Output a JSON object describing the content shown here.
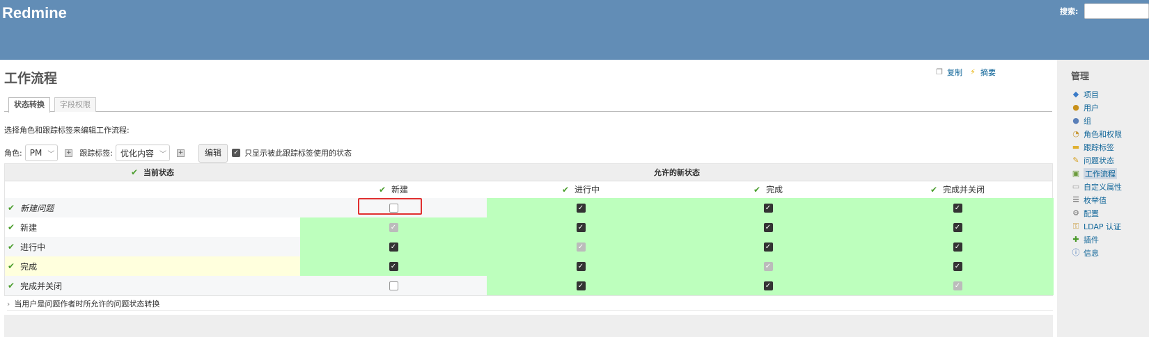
{
  "header": {
    "app_title": "Redmine",
    "search_label": "搜索:",
    "search_placeholder": ""
  },
  "page": {
    "title": "工作流程",
    "copy_label": "复制",
    "summary_label": "摘要"
  },
  "tabs": [
    {
      "label": "状态转换",
      "selected": true
    },
    {
      "label": "字段权限",
      "selected": false
    }
  ],
  "intro": "选择角色和跟踪标签来编辑工作流程:",
  "filters": {
    "role_label": "角色:",
    "role_value": "PM",
    "tracker_label": "跟踪标签:",
    "tracker_value": "优化内容",
    "edit_button": "编辑",
    "only_used_label": "只显示被此跟踪标签使用的状态"
  },
  "table": {
    "current_status_header": "当前状态",
    "new_status_header": "允许的新状态",
    "columns": [
      "新建",
      "进行中",
      "完成",
      "完成并关闭"
    ],
    "rows": [
      {
        "name": "新建问题",
        "cells": [
          "off",
          "on",
          "on",
          "on"
        ]
      },
      {
        "name": "新建",
        "cells": [
          "dis",
          "on",
          "on",
          "on"
        ]
      },
      {
        "name": "进行中",
        "cells": [
          "on",
          "dis",
          "on",
          "on"
        ]
      },
      {
        "name": "完成",
        "cells": [
          "on",
          "on",
          "dis",
          "on"
        ]
      },
      {
        "name": "完成并关闭",
        "cells": [
          "off",
          "on",
          "on",
          "dis"
        ]
      }
    ]
  },
  "note": "当用户是问题作者时所允许的问题状态转换",
  "sidebar": {
    "title": "管理",
    "items": [
      {
        "label": "项目",
        "icon": "projects-icon"
      },
      {
        "label": "用户",
        "icon": "user-icon"
      },
      {
        "label": "组",
        "icon": "group-icon"
      },
      {
        "label": "角色和权限",
        "icon": "roles-icon"
      },
      {
        "label": "跟踪标签",
        "icon": "tracker-icon"
      },
      {
        "label": "问题状态",
        "icon": "issue-status-icon"
      },
      {
        "label": "工作流程",
        "icon": "workflow-icon",
        "selected": true
      },
      {
        "label": "自定义属性",
        "icon": "custom-fields-icon"
      },
      {
        "label": "枚举值",
        "icon": "enumerations-icon"
      },
      {
        "label": "配置",
        "icon": "settings-icon"
      },
      {
        "label": "LDAP 认证",
        "icon": "ldap-icon"
      },
      {
        "label": "插件",
        "icon": "plugins-icon"
      },
      {
        "label": "信息",
        "icon": "info-icon"
      }
    ]
  }
}
